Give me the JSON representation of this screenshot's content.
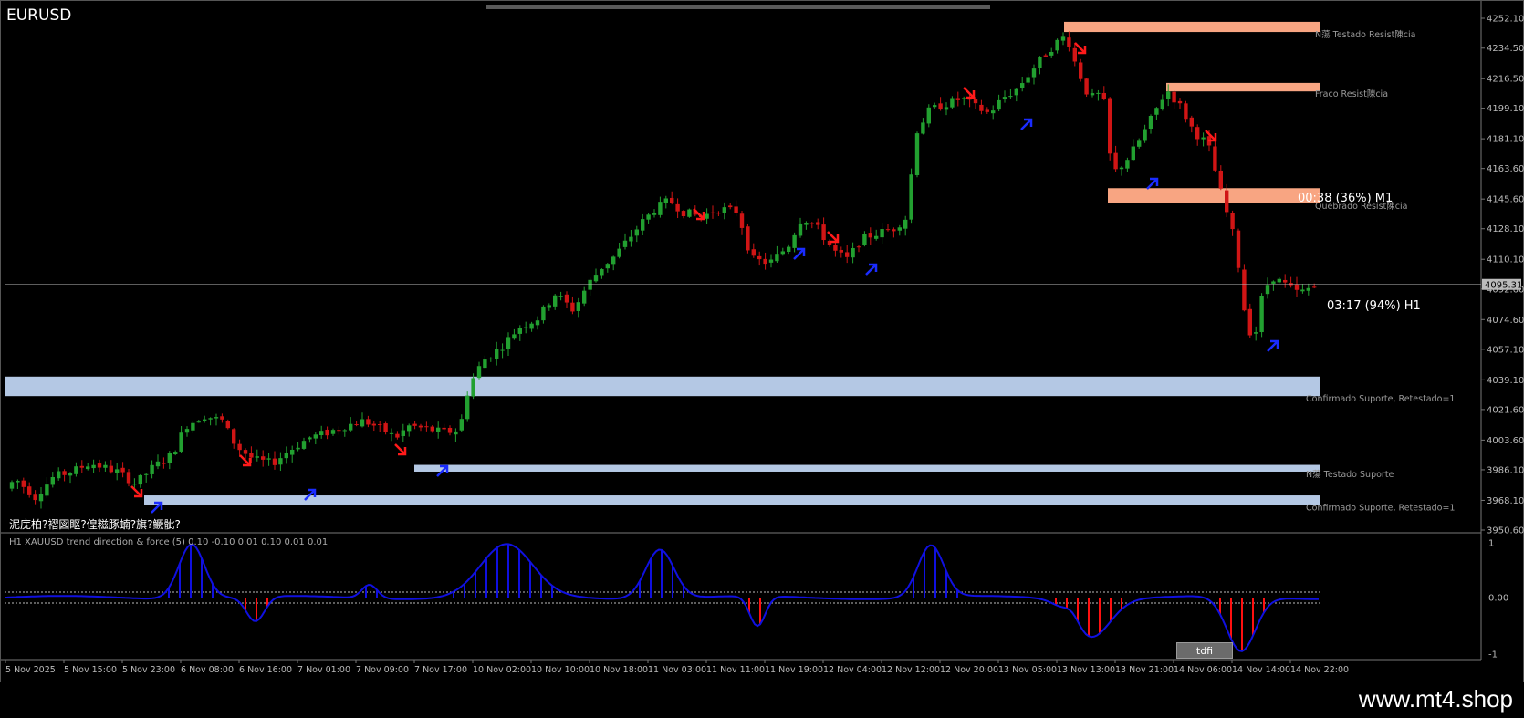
{
  "window": {
    "symbol": "EURUSD",
    "scrollbar": "chart-scroll"
  },
  "price_axis": {
    "labels": [
      "4252.10",
      "4234.50",
      "4216.50",
      "4199.10",
      "4181.10",
      "4163.60",
      "4145.60",
      "4128.10",
      "4110.10",
      "4092.60",
      "4074.60",
      "4057.10",
      "4039.10",
      "4021.60",
      "4003.60",
      "3986.10",
      "3968.10",
      "3950.60"
    ],
    "current_price": "4095.31",
    "current_color": "#bbbbbb"
  },
  "time_axis": {
    "labels": [
      "5 Nov 2025",
      "5 Nov 15:00",
      "5 Nov 23:00",
      "6 Nov 08:00",
      "6 Nov 16:00",
      "7 Nov 01:00",
      "7 Nov 09:00",
      "7 Nov 17:00",
      "10 Nov 02:00",
      "10 Nov 10:00",
      "10 Nov 18:00",
      "11 Nov 03:00",
      "11 Nov 11:00",
      "11 Nov 19:00",
      "12 Nov 04:00",
      "12 Nov 12:00",
      "12 Nov 20:00",
      "13 Nov 05:00",
      "13 Nov 13:00",
      "13 Nov 21:00",
      "14 Nov 06:00",
      "14 Nov 14:00",
      "14 Nov 22:00"
    ]
  },
  "zones": {
    "resistance": [
      {
        "label": "N蕩 Testado Resist陳cia",
        "low": 4244.0,
        "high": 4250.0
      },
      {
        "label": "Fraco Resist陳cia",
        "low": 4209.0,
        "high": 4214.0
      },
      {
        "label": "Quebrado Resist陳cia",
        "low": 4143.0,
        "high": 4152.0
      }
    ],
    "support": [
      {
        "label": "Confirmado Suporte, Retestado=1",
        "low": 4029.5,
        "high": 4041.0
      },
      {
        "label": "N蕩 Testado Suporte",
        "low": 3985.0,
        "high": 3989.0
      },
      {
        "label": "Confirmado Suporte, Retestado=1",
        "low": 3965.5,
        "high": 3971.0
      }
    ],
    "resistance_color": "#f8a582",
    "support_color": "#b4c8e4"
  },
  "timers": {
    "m1": "00:38 (36%) M1",
    "h1": "03:17 (94%) H1"
  },
  "garbled_text": "泥庑柏?褶図眍?偟糍豚蝻?旗?鳜骴?",
  "indicator": {
    "title": "H1 XAUUSD trend direction & force (5) 0.10 -0.10 0.01 0.10 0.01 0.01",
    "levels": [
      "1",
      "0.00",
      "-1"
    ],
    "upper_level": 0.1,
    "lower_level": -0.1,
    "button_label": "tdfi",
    "bull_color": "#1010e0",
    "bear_color": "#ff1010"
  },
  "colors": {
    "bull_candle": "#22a030",
    "bear_candle": "#d01515",
    "up_arrow": "#1a2cff",
    "down_arrow": "#ff1a1a"
  },
  "watermark": "www.mt4.shop"
}
